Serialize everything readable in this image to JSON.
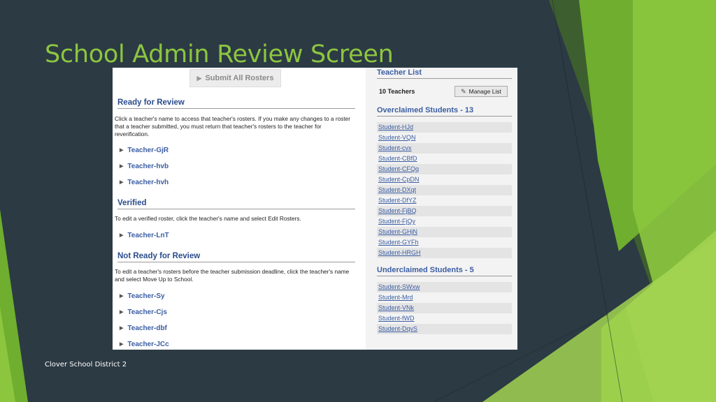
{
  "slide": {
    "title": "School Admin Review Screen",
    "footer": "Clover School District 2"
  },
  "toolbar": {
    "submit_all_label": "Submit All Rosters",
    "submit_icon": "send-icon"
  },
  "ready": {
    "heading": "Ready for Review",
    "desc": "Click a teacher's name to access that teacher's rosters. If you make any changes to a roster that a teacher submitted, you must return that teacher's rosters to the teacher for reverification.",
    "teachers": [
      "Teacher-GjR",
      "Teacher-hvb",
      "Teacher-hvh"
    ]
  },
  "verified": {
    "heading": "Verified",
    "desc": "To edit a verified roster, click the teacher's name and select Edit Rosters.",
    "teachers": [
      "Teacher-LnT"
    ]
  },
  "not_ready": {
    "heading": "Not Ready for Review",
    "desc": "To edit a teacher's rosters before the teacher submission deadline, click the teacher's name and select Move Up to School.",
    "teachers": [
      "Teacher-Sy",
      "Teacher-Cjs",
      "Teacher-dbf",
      "Teacher-JCc"
    ]
  },
  "teacher_list": {
    "heading": "Teacher List",
    "count": "10 Teachers",
    "manage_label": "Manage List",
    "manage_icon": "pencil-icon"
  },
  "overclaimed": {
    "heading": "Overclaimed Students - 13",
    "students": [
      "Student-HJd",
      "Student-VQN",
      "Student-cvx",
      "Student-CBfD",
      "Student-CFQq",
      "Student-CpDN",
      "Student-DXqt",
      "Student-DfYZ",
      "Student-FjBQ",
      "Student-FjQy",
      "Student-GHjN",
      "Student-GYFh",
      "Student-HRGH"
    ]
  },
  "underclaimed": {
    "heading": "Underclaimed Students - 5",
    "students": [
      "Student-SWxw",
      "Student-Mrd",
      "Student-VNk",
      "Student-fWD",
      "Student-DqvS"
    ]
  },
  "colors": {
    "background": "#2c3a44",
    "accent_green": "#8cc63f",
    "link_blue": "#3b5ea3"
  }
}
